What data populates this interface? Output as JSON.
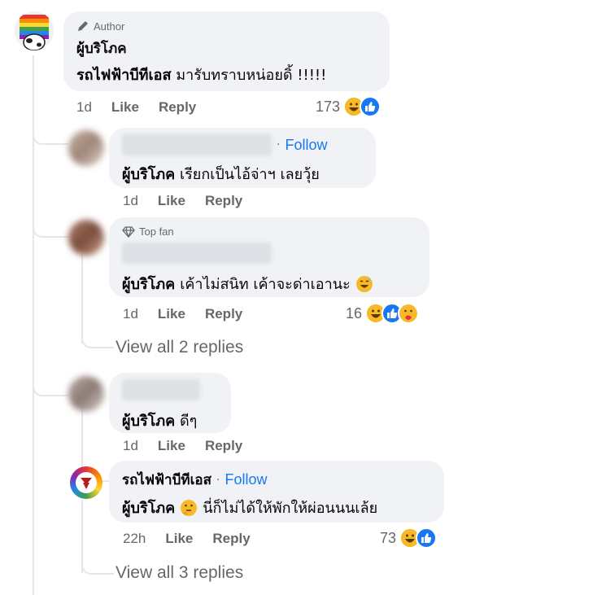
{
  "comments": [
    {
      "badge": "Author",
      "author": "ผู้บริโภค",
      "mention": "รถไฟฟ้าบีทีเอส",
      "text": "มารับทราบหน่อยดิ้ !!!!!",
      "time": "1d",
      "like": "Like",
      "reply": "Reply",
      "reaction_count": "173"
    },
    {
      "follow": "Follow",
      "mention": "ผู้บริโภค",
      "text": "เรียกเป็นไอ้จ่าฯ เลยวุ้ย",
      "time": "1d",
      "like": "Like",
      "reply": "Reply"
    },
    {
      "badge": "Top fan",
      "mention": "ผู้บริโภค",
      "text": "เค้าไม่สนิท เค้าจะด่าเอานะ",
      "time": "1d",
      "like": "Like",
      "reply": "Reply",
      "reaction_count": "16",
      "view_replies": "View all 2 replies"
    },
    {
      "mention": "ผู้บริโภค",
      "text": "ดีๆ",
      "time": "1d",
      "like": "Like",
      "reply": "Reply"
    },
    {
      "author": "รถไฟฟ้าบีทีเอส",
      "follow": "Follow",
      "mention": "ผู้บริโภค",
      "text": "นี่ก็ไม่ได้ให้พักให้ผ่อนนนเล้ย",
      "time": "22h",
      "like": "Like",
      "reply": "Reply",
      "reaction_count": "73",
      "view_replies": "View all 3 replies"
    }
  ],
  "colors": {
    "bubble": "#f0f2f5",
    "secondary_text": "#65676b",
    "link_blue": "#1877f2",
    "thread_line": "#e4e6eb"
  },
  "icons": [
    "pencil-icon",
    "diamond-icon",
    "like-reaction-icon",
    "haha-reaction-icon",
    "care-reaction-icon",
    "grin-emoji-icon",
    "sweat-smile-emoji-icon",
    "thinking-emoji-icon"
  ]
}
